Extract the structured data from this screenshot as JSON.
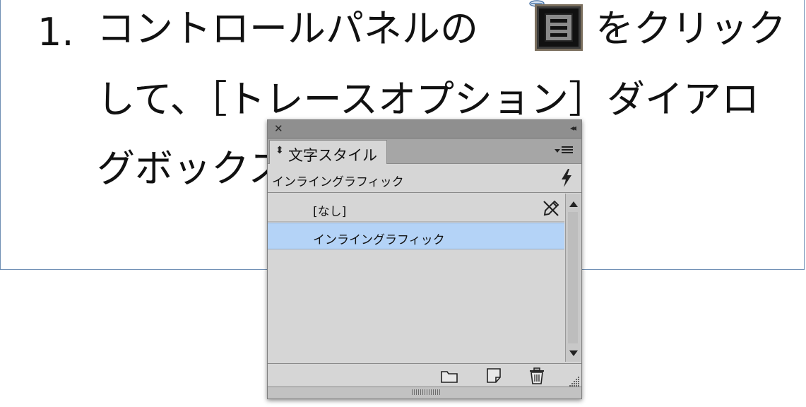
{
  "document": {
    "list_number": "1.",
    "line1_before_icon": "コントロールパネルの",
    "line1_after_icon": "をクリック",
    "line2": "して、［トレースオプション］ダイアロ",
    "line3": "グボックス"
  },
  "panel": {
    "close_glyph": "✕",
    "collapse_glyph": "◂◂",
    "tab_label": "文字スタイル",
    "tab_updown_glyph": "⬍",
    "current_style": "インライングラフィック",
    "items": [
      {
        "label": "[なし]",
        "selected": false
      },
      {
        "label": "インライングラフィック",
        "selected": true
      }
    ],
    "selection_color": "#b4d3f7"
  },
  "icons": {
    "inline_graphic": "inline-graphic-panel-icon",
    "quick_apply": "lightning-icon",
    "no_edit": "pencil-slash-icon",
    "new_group": "folder-icon",
    "new_style": "new-page-icon",
    "delete": "trash-icon",
    "resize": "resize-grip-icon"
  }
}
